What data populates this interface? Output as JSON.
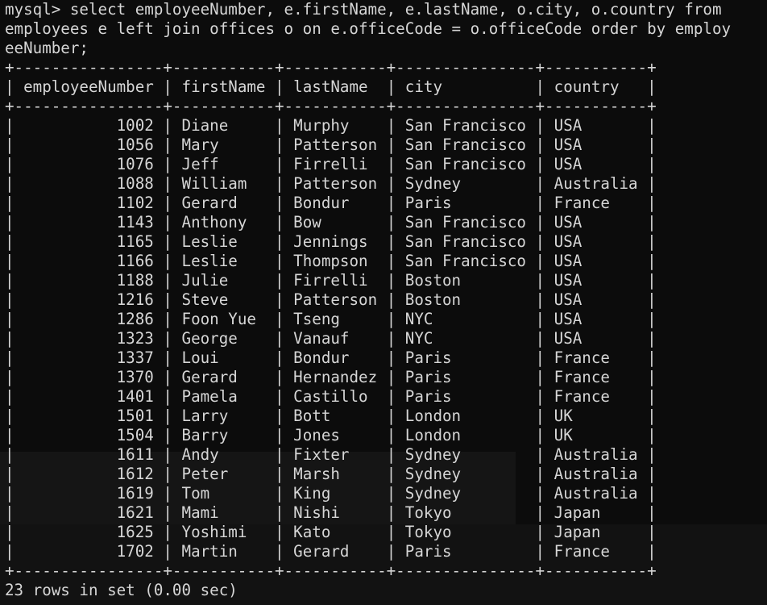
{
  "terminal": {
    "command": [
      "mysql> select employeeNumber, e.firstName, e.lastName, o.city, o.country from",
      "employees e left join offices o on e.officeCode = o.officeCode order by employ",
      "eeNumber;"
    ],
    "columns": [
      "employeeNumber",
      "firstName",
      "lastName",
      "city",
      "country"
    ],
    "rows": [
      [
        "1002",
        "Diane",
        "Murphy",
        "San Francisco",
        "USA"
      ],
      [
        "1056",
        "Mary",
        "Patterson",
        "San Francisco",
        "USA"
      ],
      [
        "1076",
        "Jeff",
        "Firrelli",
        "San Francisco",
        "USA"
      ],
      [
        "1088",
        "William",
        "Patterson",
        "Sydney",
        "Australia"
      ],
      [
        "1102",
        "Gerard",
        "Bondur",
        "Paris",
        "France"
      ],
      [
        "1143",
        "Anthony",
        "Bow",
        "San Francisco",
        "USA"
      ],
      [
        "1165",
        "Leslie",
        "Jennings",
        "San Francisco",
        "USA"
      ],
      [
        "1166",
        "Leslie",
        "Thompson",
        "San Francisco",
        "USA"
      ],
      [
        "1188",
        "Julie",
        "Firrelli",
        "Boston",
        "USA"
      ],
      [
        "1216",
        "Steve",
        "Patterson",
        "Boston",
        "USA"
      ],
      [
        "1286",
        "Foon Yue",
        "Tseng",
        "NYC",
        "USA"
      ],
      [
        "1323",
        "George",
        "Vanauf",
        "NYC",
        "USA"
      ],
      [
        "1337",
        "Loui",
        "Bondur",
        "Paris",
        "France"
      ],
      [
        "1370",
        "Gerard",
        "Hernandez",
        "Paris",
        "France"
      ],
      [
        "1401",
        "Pamela",
        "Castillo",
        "Paris",
        "France"
      ],
      [
        "1501",
        "Larry",
        "Bott",
        "London",
        "UK"
      ],
      [
        "1504",
        "Barry",
        "Jones",
        "London",
        "UK"
      ],
      [
        "1611",
        "Andy",
        "Fixter",
        "Sydney",
        "Australia"
      ],
      [
        "1612",
        "Peter",
        "Marsh",
        "Sydney",
        "Australia"
      ],
      [
        "1619",
        "Tom",
        "King",
        "Sydney",
        "Australia"
      ],
      [
        "1621",
        "Mami",
        "Nishi",
        "Tokyo",
        "Japan"
      ],
      [
        "1625",
        "Yoshimi",
        "Kato",
        "Tokyo",
        "Japan"
      ],
      [
        "1702",
        "Martin",
        "Gerard",
        "Paris",
        "France"
      ]
    ],
    "footer": "23 rows in set (0.00 sec)",
    "colors": {
      "background": "#0c0c0c",
      "text": "#d6d6d6"
    }
  }
}
